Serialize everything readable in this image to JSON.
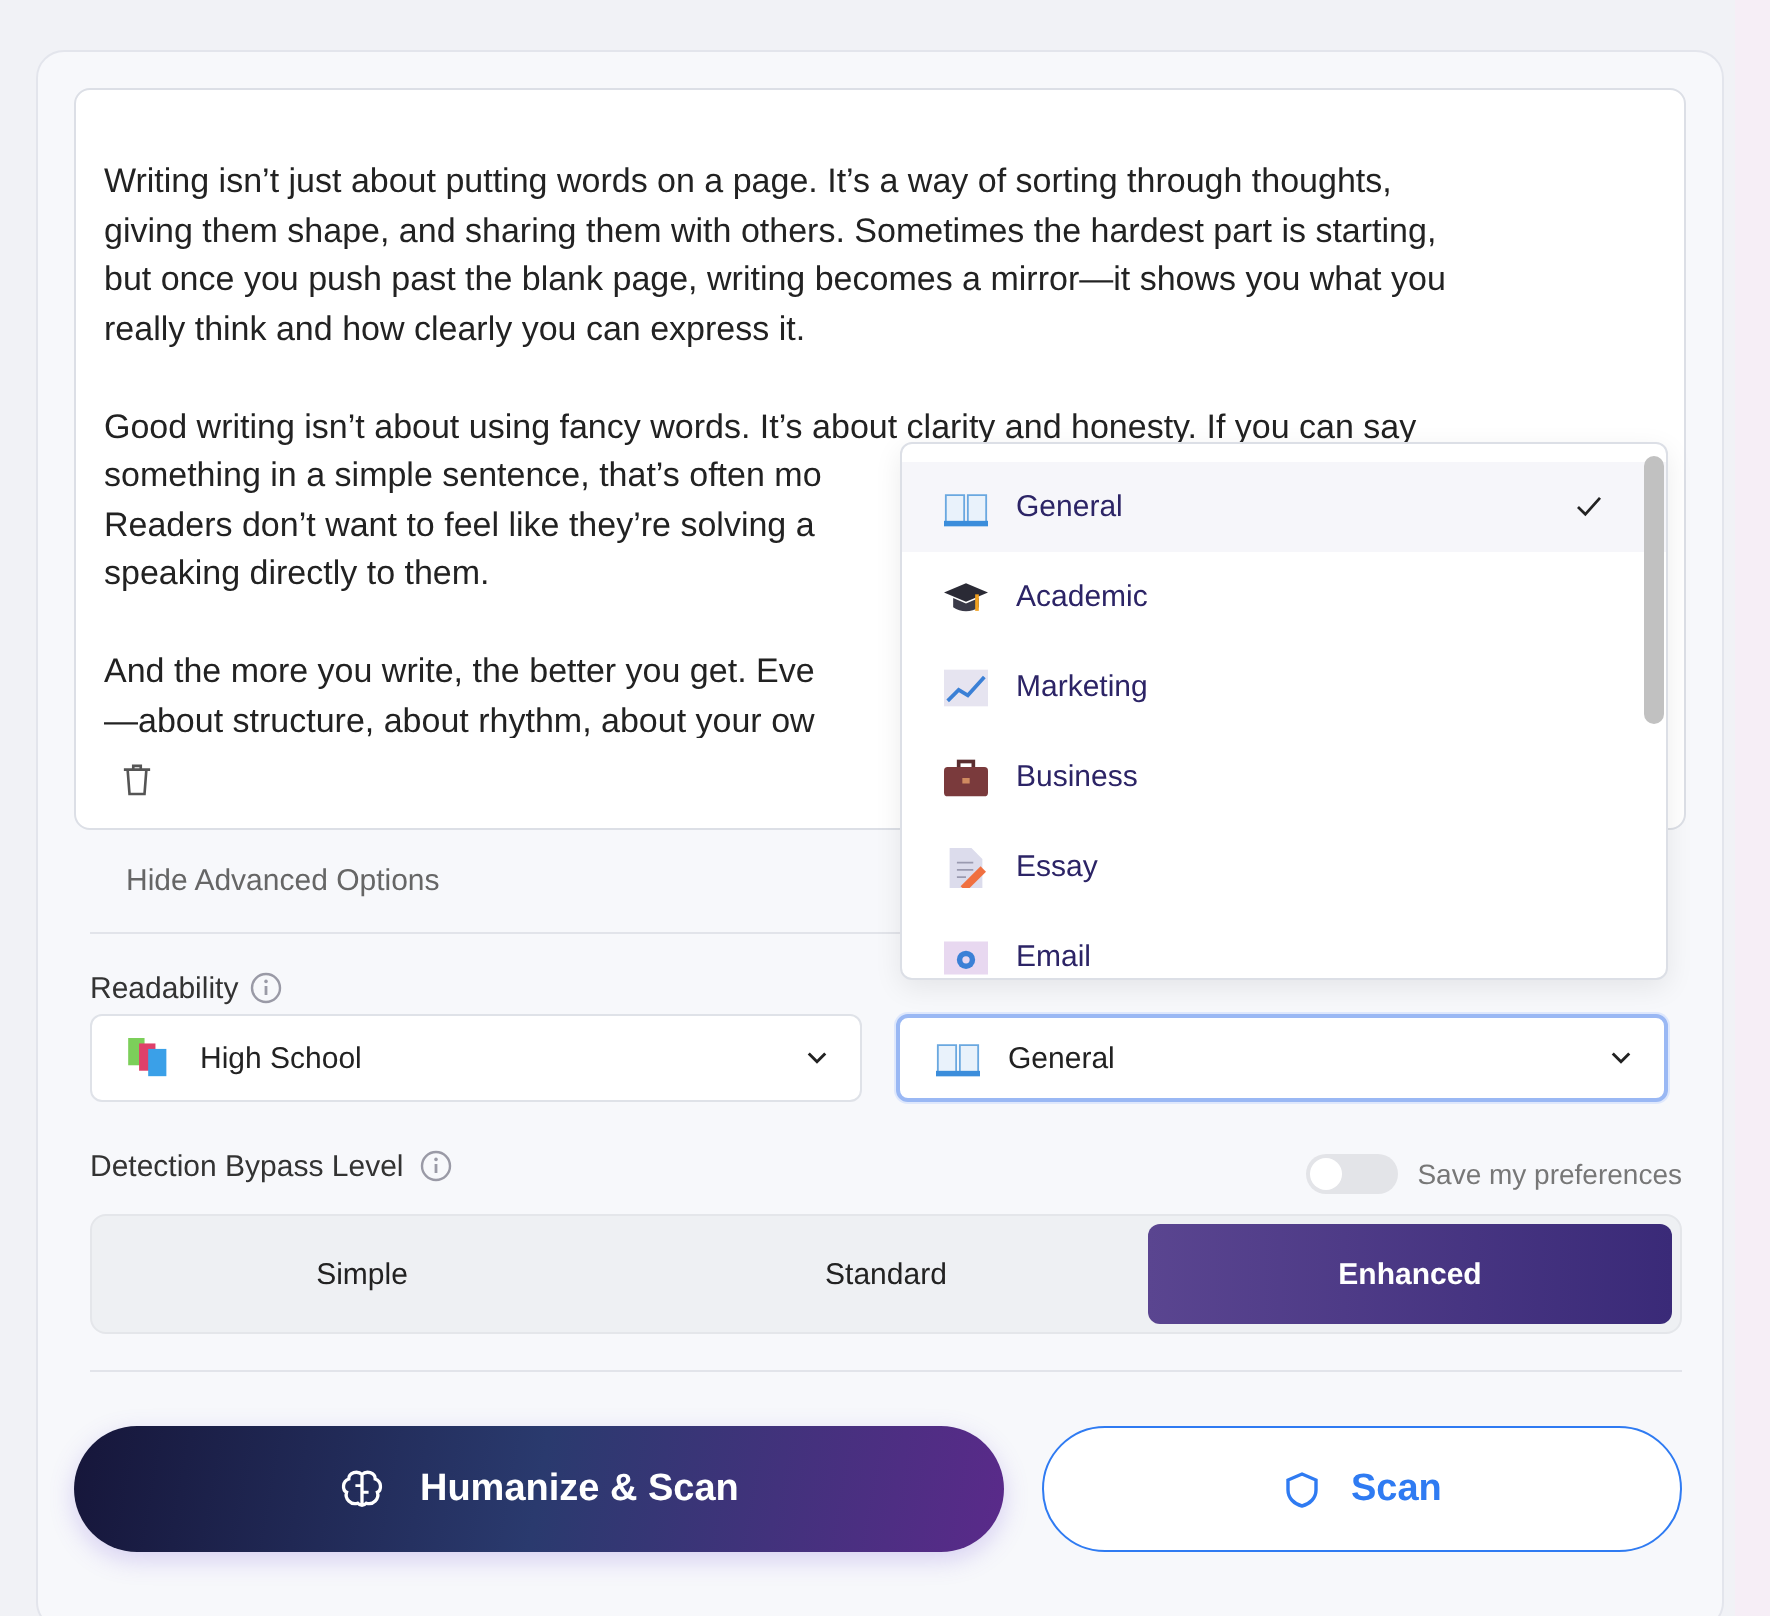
{
  "editor": {
    "paragraphs": [
      [
        "Writing isn’t just about putting words on a page. It’s a way of sorting through thoughts,",
        "giving them shape, and sharing them with others. Sometimes the hardest part is starting,",
        "but once you push past the blank page, writing becomes a mirror—it shows you what you",
        "really think and how clearly you can express it."
      ],
      [
        "Good writing isn’t about using fancy words. It’s about clarity and honesty. If you can say",
        "something in a simple sentence, that’s often mo",
        "Readers don’t want to feel like they’re solving a",
        "speaking directly to them."
      ],
      [
        "And the more you write, the better you get. Eve",
        "—about structure, about rhythm, about your ow"
      ]
    ]
  },
  "advanced_toggle": {
    "label": "Hide Advanced Options"
  },
  "readability": {
    "label": "Readability",
    "value": "High School"
  },
  "purpose": {
    "value": "General",
    "expanded": true,
    "options": [
      {
        "label": "General",
        "kind": "book",
        "selected": true
      },
      {
        "label": "Academic",
        "kind": "cap",
        "selected": false
      },
      {
        "label": "Marketing",
        "kind": "chart",
        "selected": false
      },
      {
        "label": "Business",
        "kind": "briefcase",
        "selected": false
      },
      {
        "label": "Essay",
        "kind": "document",
        "selected": false
      },
      {
        "label": "Email",
        "kind": "mail",
        "selected": false
      }
    ]
  },
  "bypass": {
    "label": "Detection Bypass Level",
    "levels": [
      {
        "label": "Simple",
        "selected": false
      },
      {
        "label": "Standard",
        "selected": false
      },
      {
        "label": "Enhanced",
        "selected": true
      }
    ]
  },
  "save_preferences": {
    "label": "Save my preferences",
    "on": false
  },
  "actions": [
    {
      "label": "Humanize & Scan",
      "kind": "primary"
    },
    {
      "label": "Scan",
      "kind": "secondary"
    }
  ]
}
